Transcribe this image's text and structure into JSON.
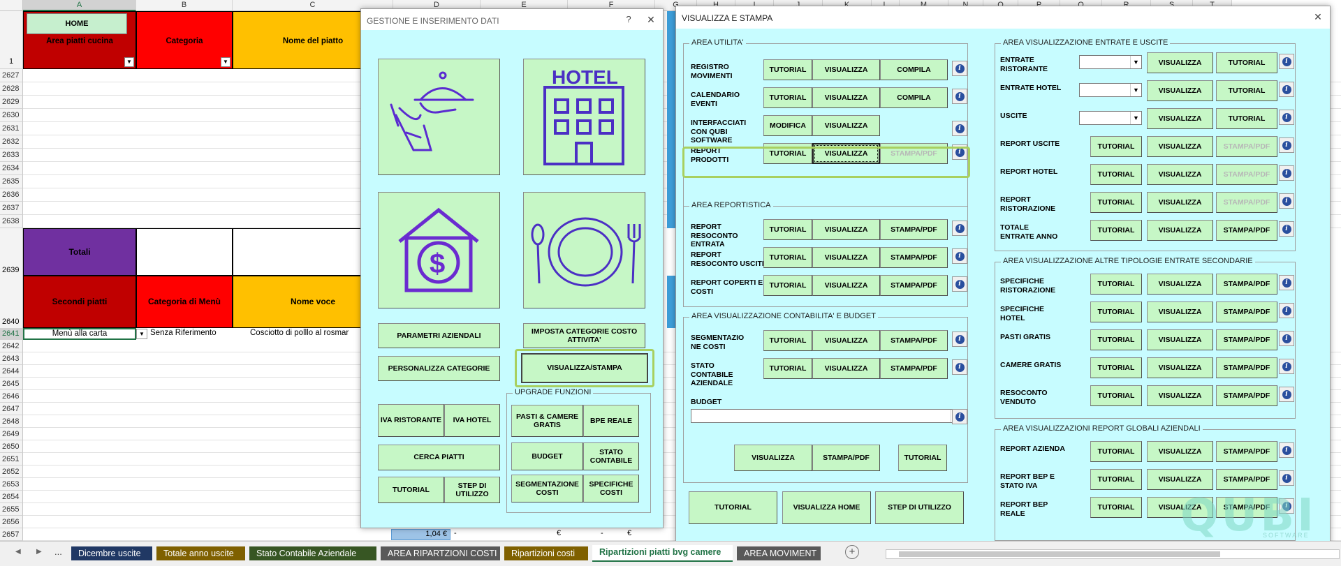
{
  "sheet": {
    "columns": [
      "A",
      "B",
      "C",
      "D",
      "E",
      "F",
      "G",
      "H",
      "I",
      "J",
      "K",
      "L",
      "M",
      "N",
      "O",
      "P",
      "Q",
      "R",
      "S",
      "T"
    ],
    "selected_column": "A",
    "home_button": "HOME",
    "header_cells": {
      "a": "Area piatti cucina",
      "b": "Categoria",
      "c": "Nome del piatto"
    },
    "header_row_num": "1",
    "rows_top": [
      "2627",
      "2628",
      "2629",
      "2630",
      "2631",
      "2632",
      "2633",
      "2634",
      "2635",
      "2636",
      "2637",
      "2638"
    ],
    "totali_row": {
      "num": "2639",
      "label": "Totali"
    },
    "sub_header": {
      "num": "2640",
      "a": "Secondi piatti",
      "b": "Categoria di Menù",
      "c": "Nome voce"
    },
    "data_row": {
      "num": "2641",
      "a": "Menù alla carta",
      "b": "Senza Riferimento",
      "c": "Cosciotto di polllo al rosmar"
    },
    "rows_bottom": [
      "2642",
      "2643",
      "2644",
      "2645",
      "2646",
      "2647",
      "2648",
      "2649",
      "2650",
      "2651",
      "2652",
      "2653",
      "2654",
      "2655",
      "2656",
      "2657"
    ],
    "row_2656_values": [
      "1,04 €",
      "-",
      "€",
      "-",
      "€"
    ],
    "row_2657_values": [
      "1,04 €",
      "0",
      "€",
      "0",
      "€"
    ],
    "colors": {
      "area_red": "#c00000",
      "categoria_red": "#ff0000",
      "nome_orange": "#ffc000",
      "totali_purple": "#7030a0",
      "home_green": "#c6efce"
    }
  },
  "dialog_gestione": {
    "title": "GESTIONE E INSERIMENTO DATI",
    "help": "?",
    "close": "✕",
    "tiles": [
      "restaurant-waiter-icon",
      "hotel-building-icon",
      "money-house-icon",
      "plate-cutlery-icon"
    ],
    "buttons": {
      "parametri": "PARAMETRI AZIENDALI",
      "imposta": "IMPOSTA CATEGORIE COSTO ATTIVITA'",
      "personalizza": "PERSONALIZZA CATEGORIE",
      "visualizza_stampa": "VISUALIZZA/STAMPA",
      "iva_ristorante": "IVA RISTORANTE",
      "iva_hotel": "IVA HOTEL",
      "cerca_piatti": "CERCA PIATTI",
      "tutorial": "TUTORIAL",
      "step": "STEP DI UTILIZZO"
    },
    "upgrade": {
      "title": "UPGRADE FUNZIONI",
      "items": [
        "PASTI & CAMERE GRATIS",
        "BPE REALE",
        "BUDGET",
        "STATO CONTABILE",
        "SEGMENTAZIONE COSTI",
        "SPECIFICHE COSTI"
      ]
    }
  },
  "dialog_visualizza": {
    "title": "VISUALIZZA E STAMPA",
    "close": "✕",
    "area_utilita": {
      "title": "AREA UTILITA'",
      "rows": [
        {
          "label": "REGISTRO MOVIMENTI",
          "b1": "TUTORIAL",
          "b2": "VISUALIZZA",
          "b3": "COMPILA"
        },
        {
          "label": "CALENDARIO EVENTI",
          "b1": "TUTORIAL",
          "b2": "VISUALIZZA",
          "b3": "COMPILA"
        },
        {
          "label": "INTERFACCIATI CON QUBI SOFTWARE",
          "b1": "MODIFICA",
          "b2": "VISUALIZZA"
        },
        {
          "label": "REPORT PRODOTTI",
          "b1": "TUTORIAL",
          "b2": "VISUALIZZA",
          "b3": "STAMPA/PDF"
        }
      ]
    },
    "area_reportistica": {
      "title": "AREA REPORTISTICA",
      "rows": [
        {
          "label": "REPORT RESOCONTO ENTRATA",
          "b1": "TUTORIAL",
          "b2": "VISUALIZZA",
          "b3": "STAMPA/PDF"
        },
        {
          "label": "REPORT RESOCONTO USCITE",
          "b1": "TUTORIAL",
          "b2": "VISUALIZZA",
          "b3": "STAMPA/PDF"
        },
        {
          "label": "REPORT COPERTI E COSTI",
          "b1": "TUTORIAL",
          "b2": "VISUALIZZA",
          "b3": "STAMPA/PDF"
        }
      ]
    },
    "area_contabilita": {
      "title": "AREA VISUALIZZAZIONE CONTABILITA' E BUDGET",
      "rows": [
        {
          "label": "SEGMENTAZIO NE COSTI",
          "b1": "TUTORIAL",
          "b2": "VISUALIZZA",
          "b3": "STAMPA/PDF"
        },
        {
          "label": "STATO CONTABILE AZIENDALE",
          "b1": "TUTORIAL",
          "b2": "VISUALIZZA",
          "b3": "STAMPA/PDF"
        }
      ],
      "budget_label": "BUDGET",
      "budget_buttons": [
        "VISUALIZZA",
        "STAMPA/PDF",
        "TUTORIAL"
      ]
    },
    "bottom_buttons": [
      "TUTORIAL",
      "VISUALIZZA HOME",
      "STEP DI UTILIZZO"
    ],
    "area_entrate": {
      "title": "AREA VISUALIZZAZIONE ENTRATE E USCITE",
      "combo_rows": [
        {
          "label": "ENTRATE RISTORANTE",
          "b1": "VISUALIZZA",
          "b2": "TUTORIAL"
        },
        {
          "label": "ENTRATE HOTEL",
          "b1": "VISUALIZZA",
          "b2": "TUTORIAL"
        },
        {
          "label": "USCITE",
          "b1": "VISUALIZZA",
          "b2": "TUTORIAL"
        }
      ],
      "rows": [
        {
          "label": "REPORT USCITE",
          "b1": "TUTORIAL",
          "b2": "VISUALIZZA",
          "b3": "STAMPA/PDF",
          "b3_disabled": true
        },
        {
          "label": "REPORT HOTEL",
          "b1": "TUTORIAL",
          "b2": "VISUALIZZA",
          "b3": "STAMPA/PDF",
          "b3_disabled": true
        },
        {
          "label": "REPORT RISTORAZIONE",
          "b1": "TUTORIAL",
          "b2": "VISUALIZZA",
          "b3": "STAMPA/PDF",
          "b3_disabled": true
        },
        {
          "label": "TOTALE ENTRATE ANNO",
          "b1": "TUTORIAL",
          "b2": "VISUALIZZA",
          "b3": "STAMPA/PDF",
          "b3_disabled": false
        }
      ]
    },
    "area_altre": {
      "title": "AREA VISUALIZZAZIONE ALTRE TIPOLOGIE ENTRATE SECONDARIE",
      "rows": [
        {
          "label": "SPECIFICHE RISTORAZIONE",
          "b1": "TUTORIAL",
          "b2": "VISUALIZZA",
          "b3": "STAMPA/PDF"
        },
        {
          "label": "SPECIFICHE HOTEL",
          "b1": "TUTORIAL",
          "b2": "VISUALIZZA",
          "b3": "STAMPA/PDF"
        },
        {
          "label": "PASTI GRATIS",
          "b1": "TUTORIAL",
          "b2": "VISUALIZZA",
          "b3": "STAMPA/PDF"
        },
        {
          "label": "CAMERE GRATIS",
          "b1": "TUTORIAL",
          "b2": "VISUALIZZA",
          "b3": "STAMPA/PDF"
        },
        {
          "label": "RESOCONTO VENDUTO",
          "b1": "TUTORIAL",
          "b2": "VISUALIZZA",
          "b3": "STAMPA/PDF"
        }
      ]
    },
    "area_globali": {
      "title": "AREA VISUALIZZAZIONI REPORT GLOBALI AZIENDALI",
      "rows": [
        {
          "label": "REPORT AZIENDA",
          "b1": "TUTORIAL",
          "b2": "VISUALIZZA",
          "b3": "STAMPA/PDF"
        },
        {
          "label": "REPORT BEP E STATO IVA",
          "b1": "TUTORIAL",
          "b2": "VISUALIZZA",
          "b3": "STAMPA/PDF"
        },
        {
          "label": "REPORT BEP REALE",
          "b1": "TUTORIAL",
          "b2": "VISUALIZZA",
          "b3": "STAMPA/PDF"
        }
      ]
    }
  },
  "watermark": {
    "brand": "QUBI",
    "sub": "SOFTWARE"
  },
  "tabs": [
    {
      "label": "Dicembre uscite",
      "bg": "#203864",
      "active": false
    },
    {
      "label": "Totale anno uscite",
      "bg": "#7f6000",
      "active": false
    },
    {
      "label": "Stato Contabile Aziendale",
      "bg": "#375623",
      "active": false
    },
    {
      "label": "AREA RIPARTZIONI COSTI",
      "bg": "#595959",
      "active": false
    },
    {
      "label": "Ripartizioni costi",
      "bg": "#7f6000",
      "active": false
    },
    {
      "label": "Ripartizioni piatti bvg camere",
      "bg": "#ffffff",
      "active": true
    },
    {
      "label": "AREA MOVIMENT",
      "bg": "#595959",
      "active": false
    }
  ],
  "tab_nav": {
    "prev": "◀",
    "next": "▶",
    "more": "...",
    "add": "+"
  }
}
